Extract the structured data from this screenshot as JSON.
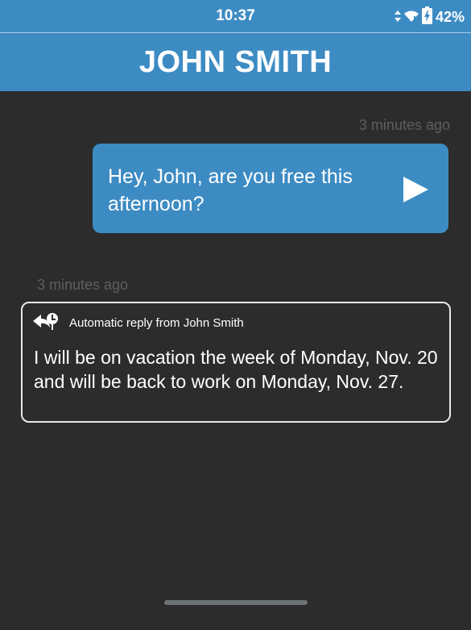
{
  "status_bar": {
    "time": "10:37",
    "battery_percent": "42%",
    "icons": [
      "data-arrows-icon",
      "wifi-icon",
      "battery-charging-icon"
    ]
  },
  "header": {
    "title": "JOHN SMITH"
  },
  "messages": [
    {
      "direction": "sent",
      "timestamp": "3 minutes ago",
      "text": "Hey, John, are you free this afternoon?",
      "icon": "send-icon"
    },
    {
      "direction": "received",
      "timestamp": "3 minutes ago",
      "label": "Automatic reply from John Smith",
      "text": "I will be on vacation the week of Monday, Nov. 20 and will be back to work on Monday, Nov. 27.",
      "icon": "auto-reply-icon"
    }
  ],
  "colors": {
    "accent": "#3d8bc3",
    "background": "#2b2c2b",
    "timestamp": "#5d5f5e",
    "bubble_border": "#e8e8e8"
  }
}
